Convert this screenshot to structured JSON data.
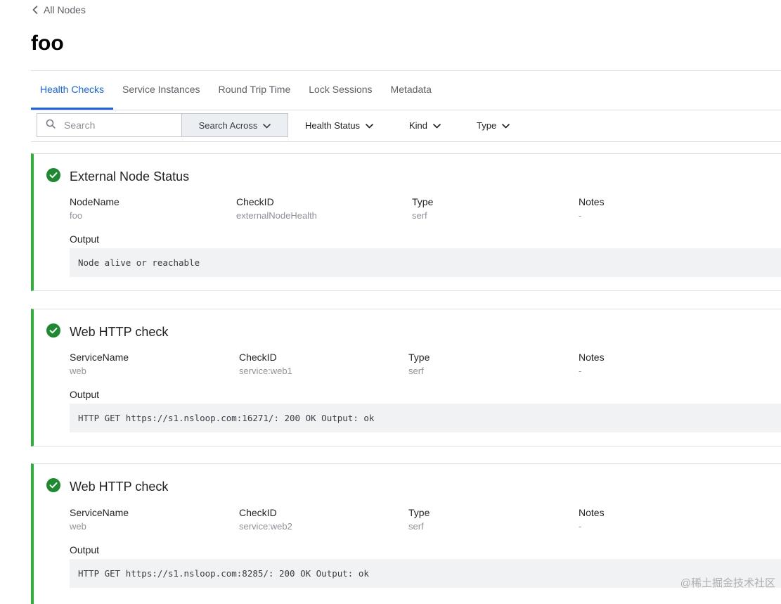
{
  "nav": {
    "back_label": "All Nodes"
  },
  "page": {
    "title": "foo"
  },
  "tabs": [
    {
      "label": "Health Checks",
      "active": true
    },
    {
      "label": "Service Instances",
      "active": false
    },
    {
      "label": "Round Trip Time",
      "active": false
    },
    {
      "label": "Lock Sessions",
      "active": false
    },
    {
      "label": "Metadata",
      "active": false
    }
  ],
  "filters": {
    "search_placeholder": "Search",
    "search_value": "",
    "search_across_label": "Search Across",
    "health_status_label": "Health Status",
    "kind_label": "Kind",
    "type_label": "Type"
  },
  "checks": [
    {
      "status": "passing",
      "title": "External Node Status",
      "fields": [
        {
          "label": "NodeName",
          "value": "foo"
        },
        {
          "label": "CheckID",
          "value": "externalNodeHealth"
        },
        {
          "label": "Type",
          "value": "serf"
        },
        {
          "label": "Notes",
          "value": "-"
        }
      ],
      "output_label": "Output",
      "output": "Node alive or reachable"
    },
    {
      "status": "passing",
      "title": "Web HTTP check",
      "fields": [
        {
          "label": "ServiceName",
          "value": "web"
        },
        {
          "label": "CheckID",
          "value": "service:web1"
        },
        {
          "label": "Type",
          "value": "serf"
        },
        {
          "label": "Notes",
          "value": "-"
        }
      ],
      "output_label": "Output",
      "output": "HTTP GET https://s1.nsloop.com:16271/: 200 OK Output: ok"
    },
    {
      "status": "passing",
      "title": "Web HTTP check",
      "fields": [
        {
          "label": "ServiceName",
          "value": "web"
        },
        {
          "label": "CheckID",
          "value": "service:web2"
        },
        {
          "label": "Type",
          "value": "serf"
        },
        {
          "label": "Notes",
          "value": "-"
        }
      ],
      "output_label": "Output",
      "output": "HTTP GET https://s1.nsloop.com:8285/: 200 OK Output: ok"
    }
  ],
  "watermark": "@稀土掘金技术社区",
  "colors": {
    "accent": "#1563ff",
    "passing": "#2eb039",
    "output_bg": "#f1f2f3"
  }
}
